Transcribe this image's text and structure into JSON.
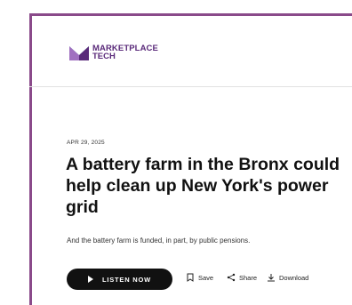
{
  "logo": {
    "line1": "MARKETPLACE",
    "line2": "TECH"
  },
  "article": {
    "date": "APR 29, 2025",
    "headline": "A battery farm in the Bronx could help clean up New York's power grid",
    "dek": "And the battery farm is funded, in part, by public pensions."
  },
  "actions": {
    "listen_label": "LISTEN NOW",
    "save_label": "Save",
    "share_label": "Share",
    "download_label": "Download"
  },
  "colors": {
    "frame": "#8a4a8a",
    "brand_purple": "#5a2a7a",
    "brand_teal": "#6fc8c8",
    "button": "#111111"
  },
  "icons": [
    "play-icon",
    "bookmark-icon",
    "share-icon",
    "download-icon"
  ]
}
